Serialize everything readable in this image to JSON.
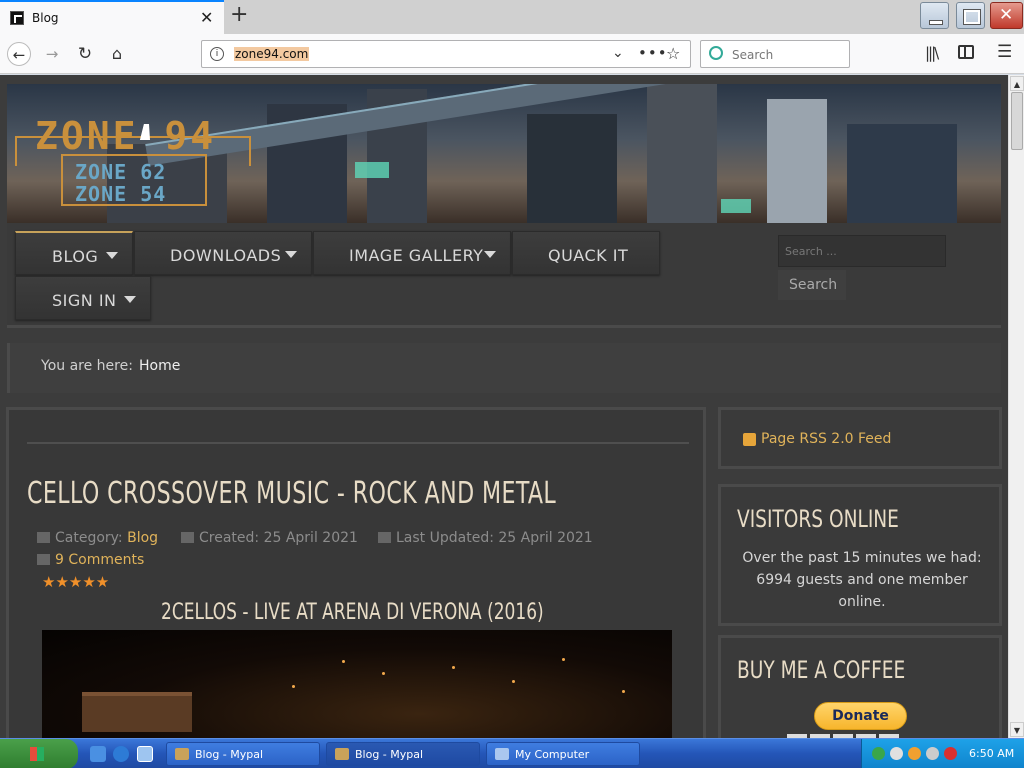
{
  "browser": {
    "tab_title": "Blog",
    "url": "zone94.com",
    "search_placeholder": "Search"
  },
  "site": {
    "logo": {
      "main": "ZONE 94",
      "sub1": "ZONE 62",
      "sub2": "ZONE 54"
    },
    "menu": {
      "blog": "BLOG",
      "downloads": "DOWNLOADS",
      "gallery": "IMAGE GALLERY",
      "quack": "QUACK IT",
      "signin": "SIGN IN"
    },
    "search": {
      "placeholder": "Search ...",
      "button": "Search"
    },
    "breadcrumb": {
      "lead": "You are here:",
      "home": "Home"
    }
  },
  "article": {
    "title": "CELLO CROSSOVER MUSIC - ROCK AND METAL",
    "category_label": "Category:",
    "category": "Blog",
    "created": "Created: 25 April 2021",
    "updated": "Last Updated: 25 April 2021",
    "comments": "9 Comments",
    "stars": "★★★★★",
    "rating": 5,
    "video_title": "2CELLOS - LIVE AT ARENA DI VERONA (2016)"
  },
  "sidebar": {
    "rss": "Page RSS 2.0 Feed",
    "visitors_title": "VISITORS ONLINE",
    "visitors_text": "Over the past 15 minutes we had: 6994 guests and one member online.",
    "coffee_title": "BUY ME A COFFEE",
    "donate": "Donate"
  },
  "taskbar": {
    "tasks": [
      "Blog - Mypal",
      "Blog - Mypal",
      "My Computer"
    ],
    "clock": "6:50 AM"
  },
  "colors": {
    "accent": "#e0b35a",
    "heading": "#e8dcc6",
    "panel": "#3a3a3a"
  }
}
